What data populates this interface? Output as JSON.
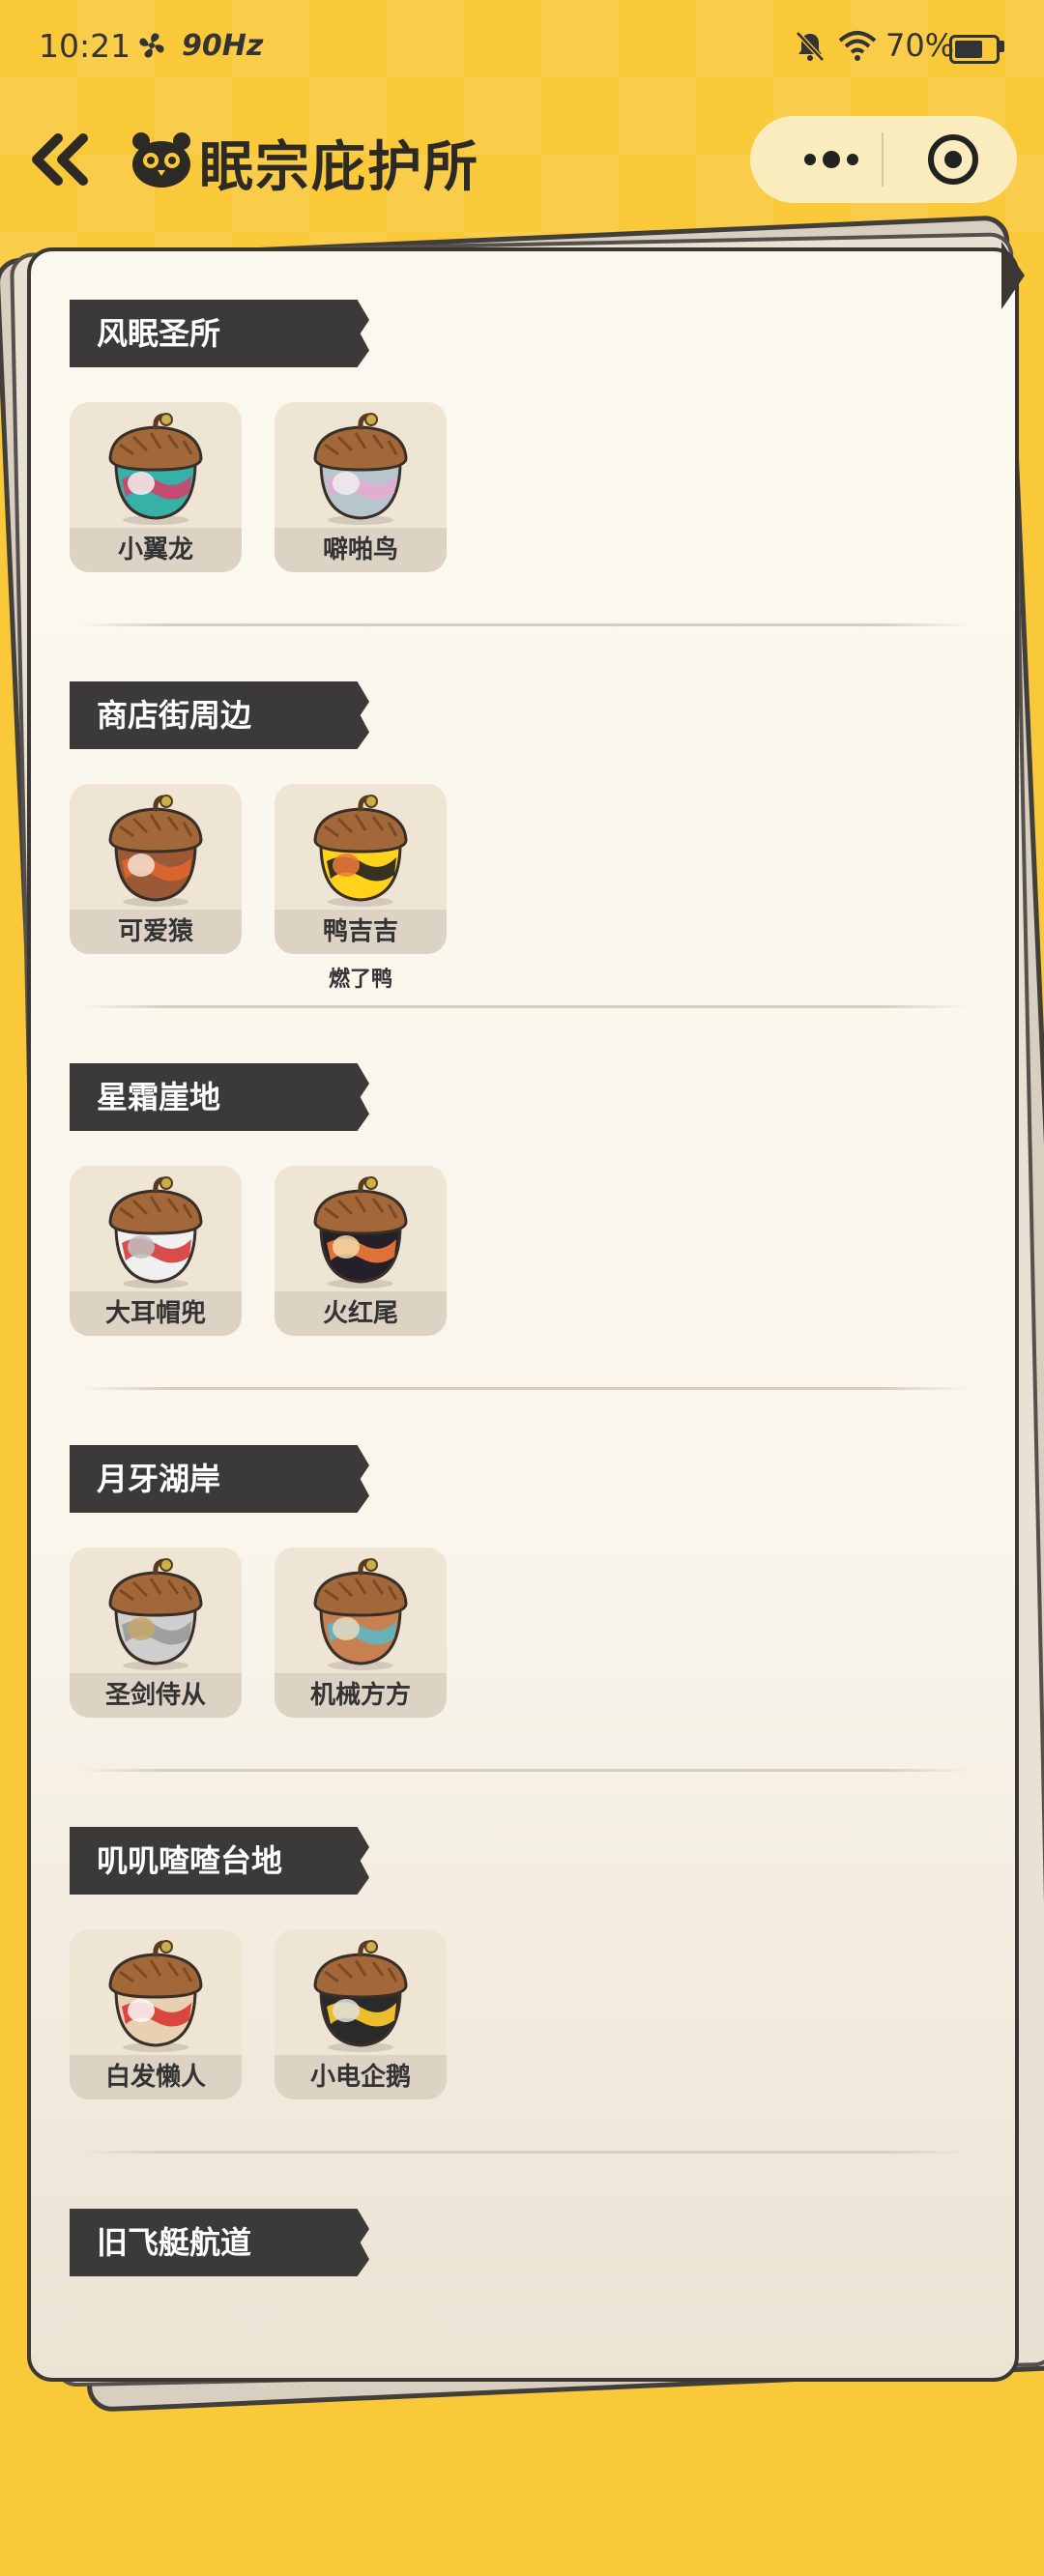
{
  "status_bar": {
    "time": "10:21",
    "refresh_rate": "90Hz",
    "battery": "70%",
    "battery_level": 0.7
  },
  "header": {
    "title": "眠宗庇护所"
  },
  "sections": [
    {
      "title": "风眠圣所",
      "items": [
        {
          "name": "小翼龙",
          "colors": [
            "#35b1a8",
            "#d4406b",
            "#f2f0ea"
          ]
        },
        {
          "name": "噼啪鸟",
          "colors": [
            "#b9c5cc",
            "#e5aad0",
            "#eeeeee"
          ]
        }
      ]
    },
    {
      "title": "商店街周边",
      "items": [
        {
          "name": "可爱猿",
          "colors": [
            "#9b5a35",
            "#e06530",
            "#f2e2cf"
          ]
        },
        {
          "name": "鸭吉吉",
          "colors": [
            "#ffd21c",
            "#202020",
            "#ee7a3a"
          ],
          "extra": "燃了鸭"
        }
      ]
    },
    {
      "title": "星霜崖地",
      "items": [
        {
          "name": "大耳帽兜",
          "colors": [
            "#f0f0f0",
            "#d73a3a",
            "#bfbfbf"
          ]
        },
        {
          "name": "火红尾",
          "colors": [
            "#252028",
            "#f27a3a",
            "#f5d9a9"
          ]
        }
      ]
    },
    {
      "title": "月牙湖岸",
      "items": [
        {
          "name": "圣剑侍从",
          "colors": [
            "#cfcfcf",
            "#999999",
            "#c7a66a"
          ]
        },
        {
          "name": "机械方方",
          "colors": [
            "#c98050",
            "#5db6c4",
            "#e6d8c0"
          ]
        }
      ]
    },
    {
      "title": "叽叽喳喳台地",
      "items": [
        {
          "name": "白发懒人",
          "colors": [
            "#e8d0b2",
            "#d83532",
            "#fafafa"
          ]
        },
        {
          "name": "小电企鹅",
          "colors": [
            "#2a2a2a",
            "#ffcf2b",
            "#e0e0e0"
          ]
        }
      ]
    },
    {
      "title": "旧飞艇航道",
      "items": []
    }
  ]
}
